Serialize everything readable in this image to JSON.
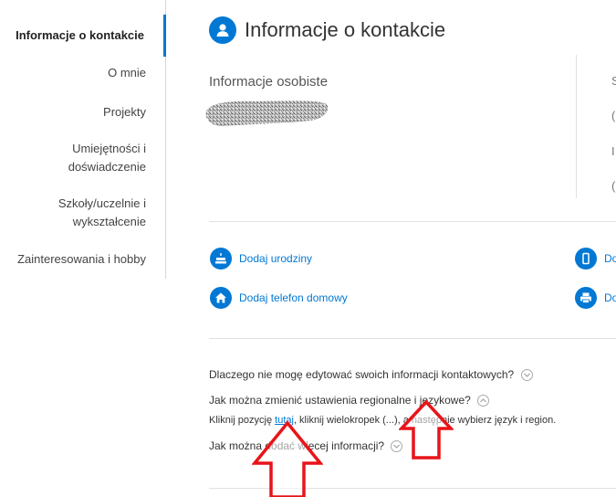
{
  "sidebar": {
    "items": [
      {
        "line1": "Informacje o kontakcie",
        "line2": ""
      },
      {
        "line1": "O mnie",
        "line2": ""
      },
      {
        "line1": "Projekty",
        "line2": ""
      },
      {
        "line1": "Umiejętności i",
        "line2": "doświadczenie"
      },
      {
        "line1": "Szkoły/uczelnie i",
        "line2": "wykształcenie"
      },
      {
        "line1": "Zainteresowania i hobby",
        "line2": ""
      }
    ],
    "active_index": 0
  },
  "header": {
    "title": "Informacje o kontakcie",
    "icon": "person-icon"
  },
  "personal": {
    "section_title": "Informacje osobiste",
    "name_redacted": true
  },
  "right_column_clipped": [
    "S",
    "(",
    "I",
    "("
  ],
  "actions": [
    {
      "label": "Dodaj urodziny",
      "icon": "cake-icon"
    },
    {
      "label": "Dodaj telefon domowy",
      "icon": "home-icon"
    },
    {
      "label": "Do",
      "icon": "mobile-phone-icon"
    },
    {
      "label": "Do",
      "icon": "fax-icon"
    }
  ],
  "faq": {
    "q1": "Dlaczego nie mogę edytować swoich informacji kontaktowych?",
    "q2": "Jak można zmienić ustawienia regionalne i językowe?",
    "answer_before": "Kliknij pozycję ",
    "answer_link": "tutaj",
    "answer_after": ", kliknij wielokropek (...), a następnie wybierz język i region.",
    "q3": "Jak można dodać więcej informacji?"
  },
  "annotations": {
    "arrow_color": "#e8141a",
    "count": 2
  },
  "colors": {
    "accent": "#0078d4",
    "annotation": "#e8141a"
  }
}
